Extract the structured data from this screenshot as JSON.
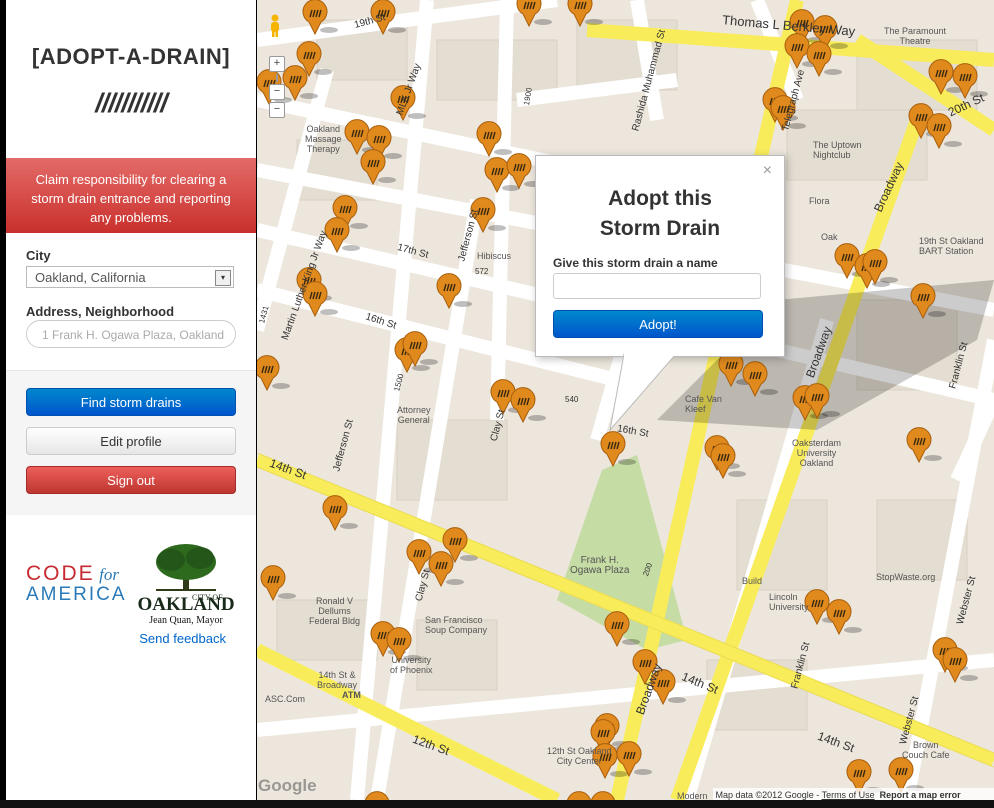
{
  "sidebar": {
    "logo": "[ADOPT-A-DRAIN]",
    "logo_slashes": "///////////",
    "banner": "Claim responsibility for clearing a storm drain entrance and reporting any problems.",
    "city_label": "City",
    "city_value": "Oakland, California",
    "address_label": "Address, Neighborhood",
    "address_placeholder": "1 Frank H. Ogawa Plaza, Oakland",
    "buttons": {
      "find": "Find storm drains",
      "edit": "Edit profile",
      "signout": "Sign out"
    },
    "cfa": {
      "code": "CODE",
      "for": "for",
      "america": "AMERICA"
    },
    "oakland": {
      "city_of": "CITY OF",
      "name": "OAKLAND",
      "mayor": "Jean Quan, Mayor"
    },
    "feedback": "Send feedback"
  },
  "popup": {
    "close": "×",
    "title": "Adopt this Storm Drain",
    "label": "Give this storm drain a name",
    "button": "Adopt!"
  },
  "map": {
    "streets": {
      "s19": "19th St",
      "thomas": "Thomas L Berkley Way",
      "s20": "20th St",
      "s17": "17th St",
      "s16a": "16th St",
      "s16b": "16th St",
      "s14a": "14th St",
      "s14b": "14th St",
      "s14c": "14th St",
      "s12": "12th St",
      "mlk1": "MLK Jr Way",
      "mlk2": "Martin Luther King Jr Way",
      "rashida": "Rashida Muhammad St",
      "telegraph": "Telegraph Ave",
      "broadway1": "Broadway",
      "broadway2": "Broadway",
      "broadway3": "Broadway",
      "clay1": "Clay St",
      "clay2": "Clay St",
      "jefferson1": "Jefferson St",
      "jefferson2": "Jefferson St",
      "franklin1": "Franklin St",
      "franklin2": "Franklin St",
      "webster1": "Webster St",
      "webster2": "Webster St",
      "n1900": "1900",
      "n572": "572",
      "n540": "540",
      "n1500": "1500",
      "n200": "200",
      "n1431": "1431"
    },
    "pois": {
      "paramount": "The Paramount\nTheatre",
      "uptown": "The Uptown\nNightclub",
      "flora": "Flora",
      "oakland_massage": "Oakland\nMassage\nTherapy",
      "hibiscus": "Hibiscus",
      "bart": "19th St Oakland\nBART Station",
      "cafe": "Cafe Van\nKleef",
      "atty": "Attorney\nGeneral",
      "oaksterdam": "Oaksterdam\nUniversity\nOakland",
      "plaza": "Frank H.\nOgawa Plaza",
      "build": "Build",
      "stopwaste": "StopWaste.org",
      "lincoln": "Lincoln\nUniversity",
      "dellums": "Ronald V\nDellums\nFederal Bldg",
      "sfsoup": "San Francisco\nSoup Company",
      "uphoenix": "University\nof Phoenix",
      "s14broadway": "14th St &\nBroadway",
      "atm": "ATM",
      "asc": "ASC.Com",
      "s12oak": "12th St Oakland\nCity Center",
      "brown": "Brown\nCouch Cafe",
      "modern": "Modern",
      "oak19": "Oak"
    },
    "attribution": "Map data ©2012 Google",
    "terms": "Terms of Use",
    "report": "Report a map error",
    "google": "Google"
  },
  "colors": {
    "pin": "#e08a1e",
    "road_yellow": "#f9ec5b",
    "road_white": "#ffffff",
    "park": "#c5dca5"
  }
}
